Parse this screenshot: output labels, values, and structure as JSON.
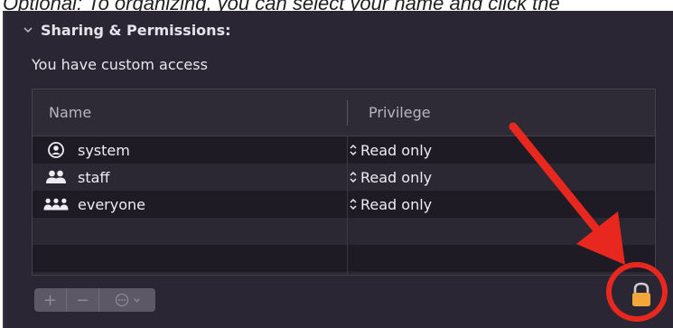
{
  "caption": "Optional: To organizing, you can select your name and click the",
  "section": {
    "title": "Sharing & Permissions:",
    "access_text": "You have custom access"
  },
  "table": {
    "columns": [
      "Name",
      "Privilege"
    ],
    "rows": [
      {
        "name": "system",
        "icon": "person-circle-icon",
        "privilege": "Read only"
      },
      {
        "name": "staff",
        "icon": "group-icon",
        "privilege": "Read only"
      },
      {
        "name": "everyone",
        "icon": "everyone-icon",
        "privilege": "Read only"
      }
    ],
    "empty_rows": 3
  },
  "toolbar": {
    "add_label": "+",
    "remove_label": "−",
    "action_label": "⋯"
  },
  "annotation": {
    "arrow_color": "#e8281e",
    "lock_color": "#f3a63a"
  }
}
